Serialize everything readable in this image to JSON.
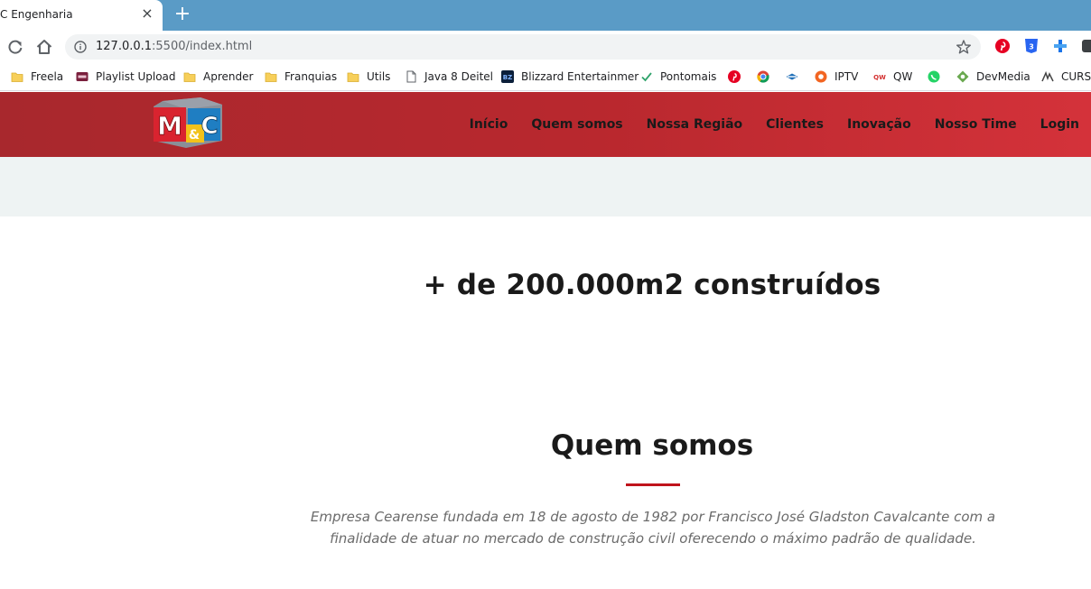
{
  "browser": {
    "tab_title": "C Engenharia",
    "tab_close": "×",
    "new_tab": "+",
    "url_host": "127.0.0.1",
    "url_rest": ":5500/index.html"
  },
  "bookmarks": [
    {
      "label": "Freela",
      "icon": "folder-icon"
    },
    {
      "label": "Playlist Upload",
      "icon": "iptv-icon"
    },
    {
      "label": "Aprender",
      "icon": "folder-icon"
    },
    {
      "label": "Franquias",
      "icon": "folder-icon"
    },
    {
      "label": "Utils",
      "icon": "folder-icon"
    },
    {
      "label": "Java 8 Deitel",
      "icon": "page-icon"
    },
    {
      "label": "Blizzard Entertainmer",
      "icon": "blizzard-icon"
    },
    {
      "label": "Pontomais",
      "icon": "check-icon"
    },
    {
      "label": "",
      "icon": "pinterest-icon"
    },
    {
      "label": "",
      "icon": "chrome-icon"
    },
    {
      "label": "",
      "icon": "diamond-icon"
    },
    {
      "label": "IPTV",
      "icon": "iptv-orange-icon"
    },
    {
      "label": "QW",
      "icon": "qw-icon"
    },
    {
      "label": "",
      "icon": "whatsapp-icon"
    },
    {
      "label": "DevMedia",
      "icon": "devmedia-icon"
    },
    {
      "label": "CURSO",
      "icon": "curso-icon"
    }
  ],
  "site": {
    "logo_alt": "M&C",
    "menu": [
      "Início",
      "Quem somos",
      "Nossa Região",
      "Clientes",
      "Inovação",
      "Nosso Time",
      "Login"
    ],
    "stat_text": "+ de 200.000m2 construídos",
    "about_title": "Quem somos",
    "about_text": "Empresa Cearense fundada em 18 de agosto de 1982 por Francisco José Gladston Cavalcante com a finalidade de atuar no mercado de construção civil oferecendo o máximo padrão de qualidade."
  },
  "colors": {
    "header_red": "#b9282e",
    "accent_rule": "#c0141c",
    "band_bg": "#eef3f3",
    "tabstrip_blue": "#5a9bc6"
  }
}
